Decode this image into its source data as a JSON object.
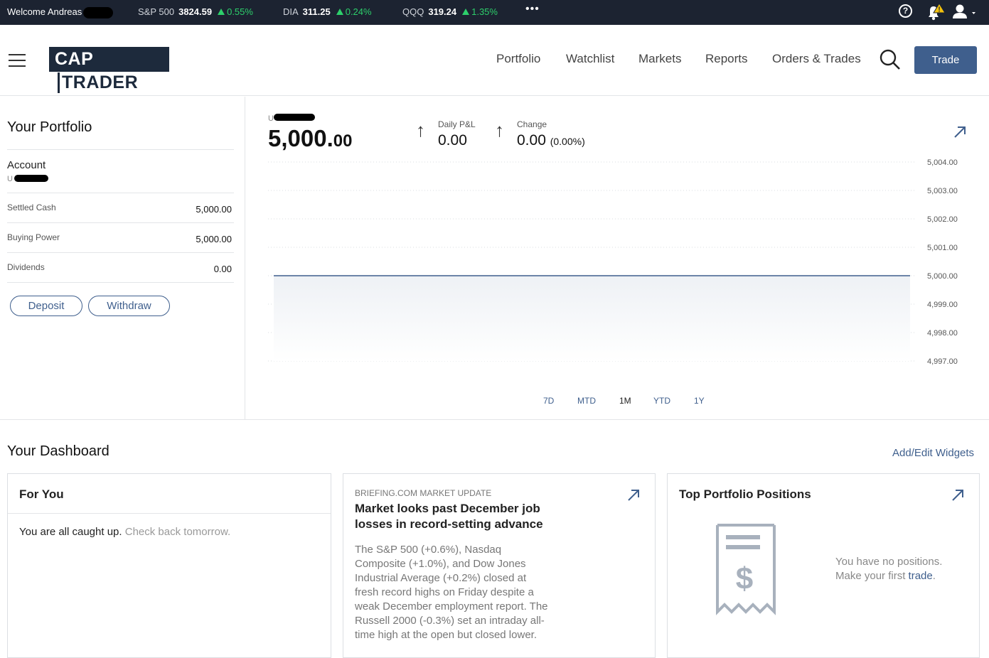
{
  "ticker": {
    "welcome": "Welcome Andreas",
    "quotes": [
      {
        "symbol": "S&P 500",
        "price": "3824.59",
        "change": "0.55%"
      },
      {
        "symbol": "DIA",
        "price": "311.25",
        "change": "0.24%"
      },
      {
        "symbol": "QQQ",
        "price": "319.24",
        "change": "1.35%"
      }
    ],
    "more": "•••",
    "help_glyph": "?",
    "alert_badge": "!"
  },
  "header": {
    "logo_part1": "CAP",
    "logo_part2": "TRADER",
    "nav": [
      "Portfolio",
      "Watchlist",
      "Markets",
      "Reports",
      "Orders & Trades"
    ],
    "trade_button": "Trade"
  },
  "portfolio": {
    "title": "Your Portfolio",
    "account_label": "Account",
    "account_prefix": "U",
    "rows": [
      {
        "label": "Settled Cash",
        "value": "5,000.00"
      },
      {
        "label": "Buying Power",
        "value": "5,000.00"
      },
      {
        "label": "Dividends",
        "value": "0.00"
      }
    ],
    "deposit": "Deposit",
    "withdraw": "Withdraw"
  },
  "summary": {
    "account_prefix": "U",
    "balance_main": "5,000.",
    "balance_cents": "00",
    "daily_pnl_label": "Daily P&L",
    "daily_pnl_value": "0.00",
    "change_label": "Change",
    "change_value": "0.00",
    "change_pct": "(0.00%)"
  },
  "chart_data": {
    "type": "area",
    "y_ticks": [
      "5,004.00",
      "5,003.00",
      "5,002.00",
      "5,001.00",
      "5,000.00",
      "4,999.00",
      "4,998.00",
      "4,997.00"
    ],
    "ylim": [
      4997,
      5004
    ],
    "series": [
      {
        "values": [
          5000,
          5000
        ]
      }
    ],
    "ranges": [
      "7D",
      "MTD",
      "1M",
      "YTD",
      "1Y"
    ],
    "active_range": "1M"
  },
  "dashboard": {
    "title": "Your Dashboard",
    "add_edit": "Add/Edit Widgets",
    "for_you": {
      "title": "For You",
      "msg_bold": "You are all caught up.",
      "msg_muted": "Check back tomorrow."
    },
    "news": {
      "source": "BRIEFING.COM MARKET UPDATE",
      "headline": "Market looks past December job losses in record-setting advance",
      "body": "The S&P 500 (+0.6%), Nasdaq Composite (+1.0%), and Dow Jones Industrial Average (+0.2%) closed at fresh record highs on Friday despite a weak December employment report. The Russell 2000 (-0.3%) set an intraday all-time high at the open but closed lower."
    },
    "positions": {
      "title": "Top Portfolio Positions",
      "line1": "You have no positions.",
      "line2_prefix": "Make your first",
      "line2_link": "trade",
      "line2_suffix": "."
    }
  }
}
